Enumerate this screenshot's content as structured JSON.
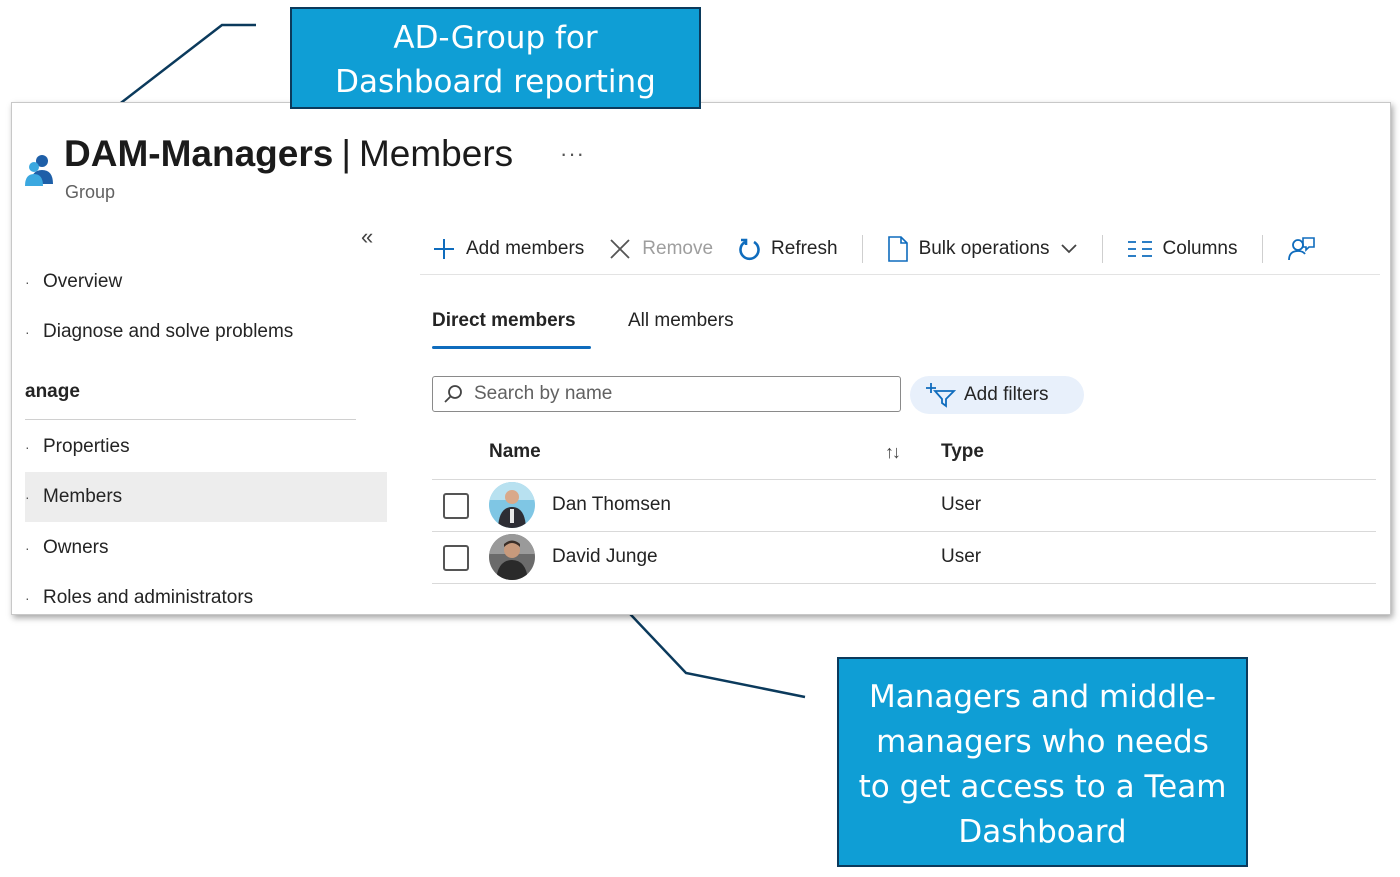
{
  "annotations": {
    "top_lines": [
      "AD-Group for",
      "Dashboard reporting"
    ],
    "bottom_lines": [
      "Managers and middle-",
      "managers who needs",
      "to get access to a Team",
      "Dashboard"
    ]
  },
  "header": {
    "group_name": "DAM-Managers",
    "separator": "|",
    "page": "Members",
    "more": "···",
    "subtitle": "Group"
  },
  "sidebar": {
    "collapse": "«",
    "items": [
      {
        "label": "Overview"
      },
      {
        "label": "Diagnose and solve problems"
      },
      {
        "label": "Properties"
      },
      {
        "label": "Members",
        "selected": true
      },
      {
        "label": "Owners"
      },
      {
        "label": "Roles and administrators"
      }
    ],
    "section": "anage"
  },
  "toolbar": {
    "add": "Add members",
    "remove": "Remove",
    "refresh": "Refresh",
    "bulk": "Bulk operations",
    "columns": "Columns"
  },
  "tabs": [
    {
      "label": "Direct members",
      "active": true
    },
    {
      "label": "All members",
      "active": false
    }
  ],
  "search": {
    "placeholder": "Search by name",
    "value": ""
  },
  "filters": {
    "label": "Add filters"
  },
  "table": {
    "columns": [
      "Name",
      "Type"
    ],
    "rows": [
      {
        "name": "Dan Thomsen",
        "type": "User"
      },
      {
        "name": "David Junge",
        "type": "User"
      }
    ]
  },
  "colors": {
    "callout_fill": "#0f9ed5",
    "callout_border": "#0b3a5c",
    "accent": "#0f6cbd",
    "selected_nav": "#ededed"
  }
}
